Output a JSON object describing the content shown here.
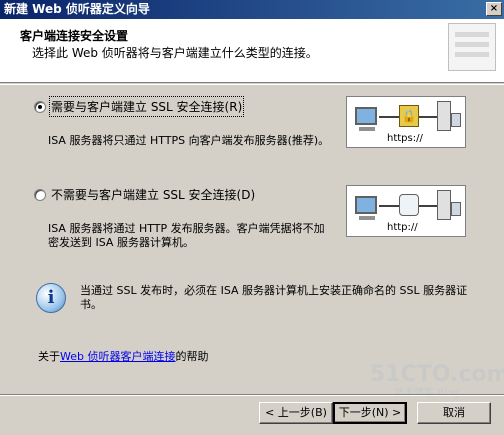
{
  "window": {
    "title": "新建 Web 侦听器定义向导",
    "close_glyph": "×"
  },
  "header": {
    "title": "客户端连接安全设置",
    "subtitle": "选择此 Web 侦听器将与客户端建立什么类型的连接。"
  },
  "options": [
    {
      "label": "需要与客户端建立 SSL 安全连接(R)",
      "selected": true,
      "description": "ISA 服务器将只通过 HTTPS 向客户端发布服务器(推荐)。",
      "diagram_label": "https://",
      "diagram_icon": "lock-icon"
    },
    {
      "label": "不需要与客户端建立 SSL 安全连接(D)",
      "selected": false,
      "description": "ISA 服务器将通过 HTTP 发布服务器。客户端凭据将不加密发送到 ISA 服务器计算机。",
      "diagram_label": "http://",
      "diagram_icon": "open-connection-icon"
    }
  ],
  "info": {
    "icon": "info-icon",
    "glyph": "i",
    "text": "当通过 SSL 发布时，必须在 ISA 服务器计算机上安装正确命名的 SSL 服务器证书。"
  },
  "help": {
    "prefix": "关于",
    "link": "Web 侦听器客户端连接",
    "suffix": "的帮助"
  },
  "buttons": {
    "back": "< 上一步(B)",
    "next": "下一步(N) >",
    "cancel": "取消"
  },
  "watermark": {
    "main": "51CTO.com",
    "sub": "技术博客 Blog"
  }
}
